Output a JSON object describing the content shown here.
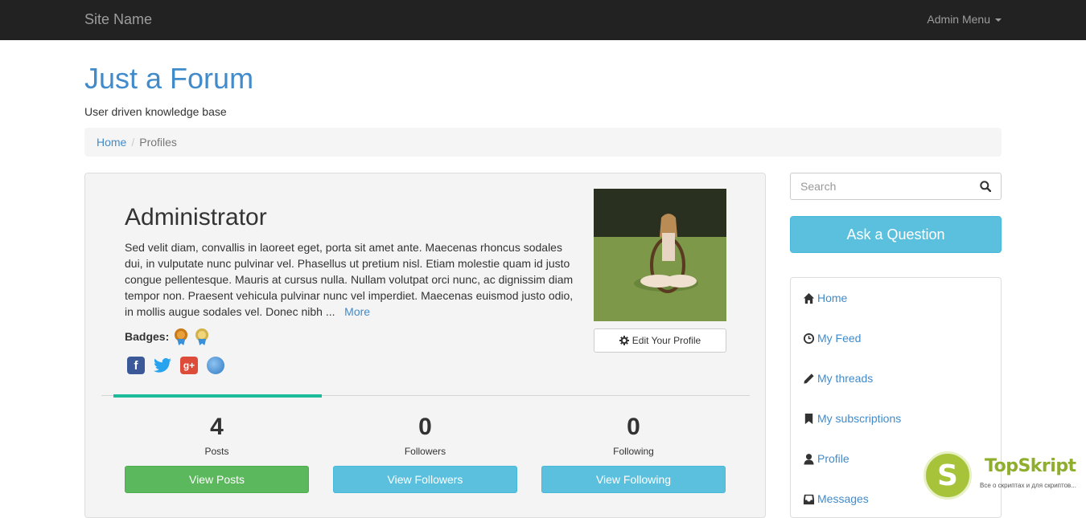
{
  "navbar": {
    "brand": "Site Name",
    "admin_menu": "Admin Menu"
  },
  "header": {
    "title": "Just a Forum",
    "tagline": "User driven knowledge base"
  },
  "breadcrumb": {
    "home": "Home",
    "separator": "/",
    "current": "Profiles"
  },
  "profile": {
    "name": "Administrator",
    "bio": "Sed velit diam, convallis in laoreet eget, porta sit amet ante. Maecenas rhoncus sodales dui, in vulputate nunc pulvinar vel. Phasellus ut pretium nisl. Etiam molestie quam id justo congue pellentesque. Mauris at cursus nulla. Nullam volutpat orci nunc, ac dignissim diam tempor non. Praesent vehicula pulvinar nunc vel imperdiet. Maecenas euismod justo odio, in mollis augue sodales vel. Donec nibh ...",
    "more_link": "More",
    "badges_label": "Badges:",
    "badges": [
      "medal-icon",
      "medal-icon"
    ],
    "social": [
      "facebook-icon",
      "twitter-icon",
      "google-plus-icon",
      "website-globe-icon"
    ],
    "edit_button": "Edit Your Profile",
    "accent_color": "#1abc9c"
  },
  "stats": [
    {
      "value": "4",
      "label": "Posts",
      "button": "View Posts",
      "button_color": "#5cb85c"
    },
    {
      "value": "0",
      "label": "Followers",
      "button": "View Followers",
      "button_color": "#5bc0de"
    },
    {
      "value": "0",
      "label": "Following",
      "button": "View Following",
      "button_color": "#5bc0de"
    }
  ],
  "sidebar": {
    "search_placeholder": "Search",
    "ask_button": "Ask a Question",
    "nav": [
      {
        "label": "Home",
        "icon": "home-icon"
      },
      {
        "label": "My Feed",
        "icon": "clock-icon"
      },
      {
        "label": "My threads",
        "icon": "pencil-icon"
      },
      {
        "label": "My subscriptions",
        "icon": "bookmark-icon"
      },
      {
        "label": "Profile",
        "icon": "user-icon"
      },
      {
        "label": "Messages",
        "icon": "inbox-icon"
      }
    ]
  },
  "watermark": {
    "letter": "S",
    "name": "TopSkript",
    "subtitle": "Все о скриптах и для скриптов..."
  }
}
